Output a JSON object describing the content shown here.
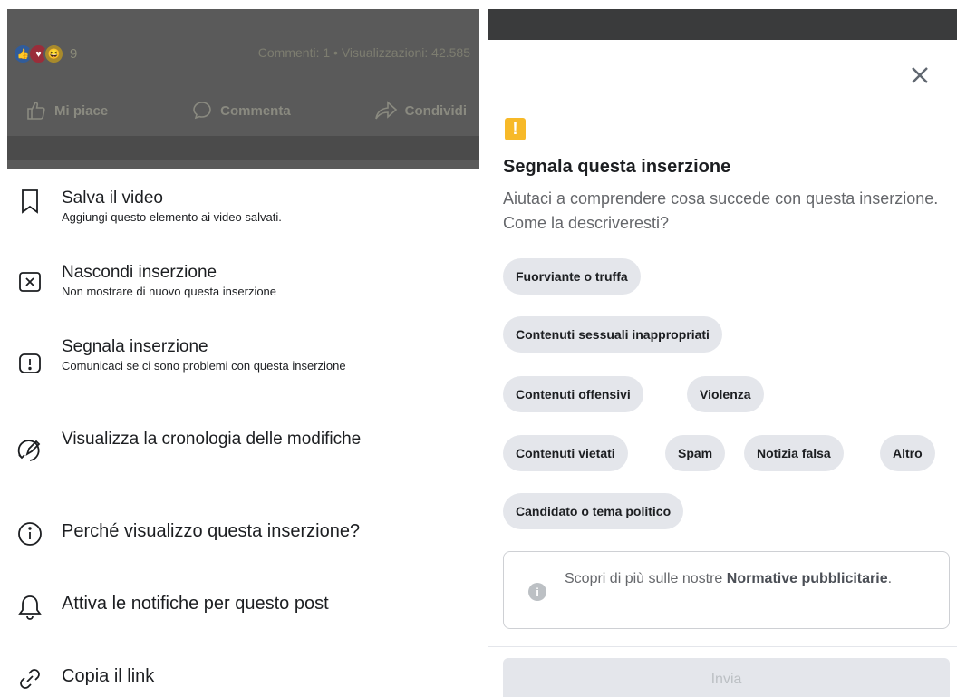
{
  "left_panel": {
    "post": {
      "reaction_count": "9",
      "stats": "Commenti: 1 • Visualizzazioni: 42.585",
      "actions": [
        {
          "label": "Mi piace",
          "icon": "thumbs-up-icon"
        },
        {
          "label": "Commenta",
          "icon": "comment-icon"
        },
        {
          "label": "Condividi",
          "icon": "share-icon"
        }
      ]
    },
    "menu": [
      {
        "title": "Salva il video",
        "subtitle": "Aggiungi questo elemento ai video salvati.",
        "icon": "bookmark-icon"
      },
      {
        "title": "Nascondi inserzione",
        "subtitle": "Non mostrare di nuovo questa inserzione",
        "icon": "hide-x-icon"
      },
      {
        "title": "Segnala inserzione",
        "subtitle": "Comunicaci se ci sono problemi con questa inserzione",
        "icon": "report-exclamation-icon"
      },
      {
        "title": "Visualizza la cronologia delle modifiche",
        "subtitle": "",
        "icon": "edit-history-icon"
      },
      {
        "title": "Perché visualizzo questa inserzione?",
        "subtitle": "",
        "icon": "info-icon"
      },
      {
        "title": "Attiva le notifiche per questo post",
        "subtitle": "",
        "icon": "bell-icon"
      },
      {
        "title": "Copia il link",
        "subtitle": "",
        "icon": "link-icon"
      }
    ]
  },
  "right_panel": {
    "close_icon": "close-icon",
    "warning_icon": "warning-badge-icon",
    "title": "Segnala questa inserzione",
    "description": "Aiutaci a comprendere cosa succede con questa inserzione. Come la descriveresti?",
    "options": [
      "Fuorviante o truffa",
      "Contenuti sessuali inappropriati",
      "Contenuti offensivi",
      "Violenza",
      "Contenuti vietati",
      "Spam",
      "Notizia falsa",
      "Altro",
      "Candidato o tema politico"
    ],
    "info": {
      "text_prefix": "Scopri di più sulle nostre ",
      "link_text": "Normative pubblicitarie",
      "text_suffix": "."
    },
    "submit_label": "Invia"
  },
  "colors": {
    "warning": "#f7b928",
    "chip_bg": "#e4e6eb",
    "disabled_text": "#bcc0c4"
  }
}
